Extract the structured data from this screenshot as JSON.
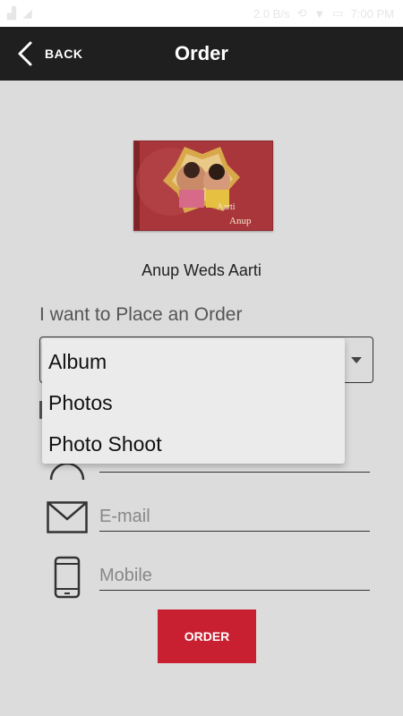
{
  "statusbar": {
    "network_speed": "2.0 B/s",
    "time": "7:00 PM"
  },
  "appbar": {
    "back_label": "BACK",
    "title": "Order"
  },
  "album": {
    "cover_text_line1": "Aarti",
    "cover_text_line2": "Anup",
    "caption": "Anup Weds Aarti"
  },
  "form": {
    "order_label": "I want to Place an Order",
    "dropdown_options": [
      "Album",
      "Photos",
      "Photo Shoot"
    ],
    "email_placeholder": "E-mail",
    "mobile_placeholder": "Mobile",
    "order_button": "ORDER"
  },
  "colors": {
    "background": "#dcdcdc",
    "appbar": "#1f1f1f",
    "button": "#c82030"
  }
}
